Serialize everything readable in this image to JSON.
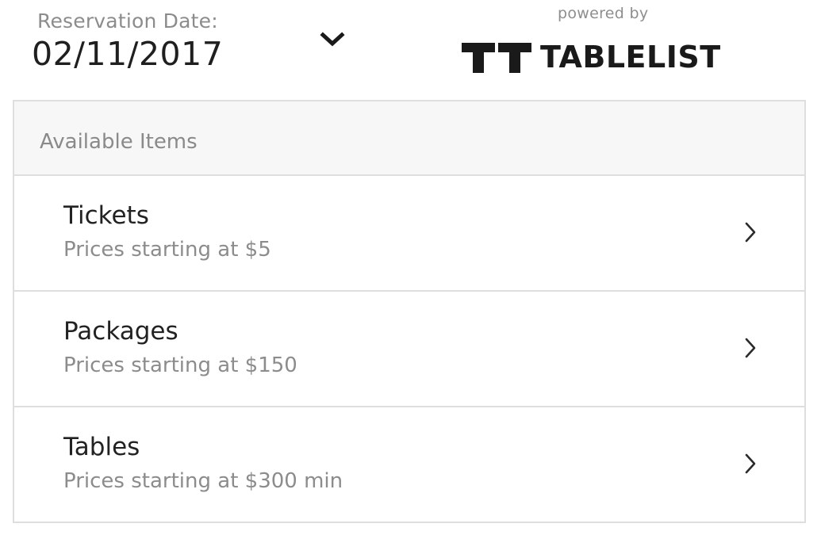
{
  "header": {
    "date_label": "Reservation Date:",
    "date_value": "02/11/2017",
    "powered_by": "powered by",
    "brand_name": "TABLELIST",
    "logo_icon": "tablelist-logo-icon",
    "dropdown_icon": "chevron-down-icon"
  },
  "panel": {
    "title": "Available Items",
    "items": [
      {
        "name": "Tickets",
        "price": "Prices starting at $5",
        "icon": "chevron-right-icon"
      },
      {
        "name": "Packages",
        "price": "Prices starting at $150",
        "icon": "chevron-right-icon"
      },
      {
        "name": "Tables",
        "price": "Prices starting at $300 min",
        "icon": "chevron-right-icon"
      }
    ]
  },
  "colors": {
    "border": "#dedede",
    "header_bg": "#f7f7f7",
    "muted_text": "#8c8c8c",
    "primary_text": "#222222"
  }
}
